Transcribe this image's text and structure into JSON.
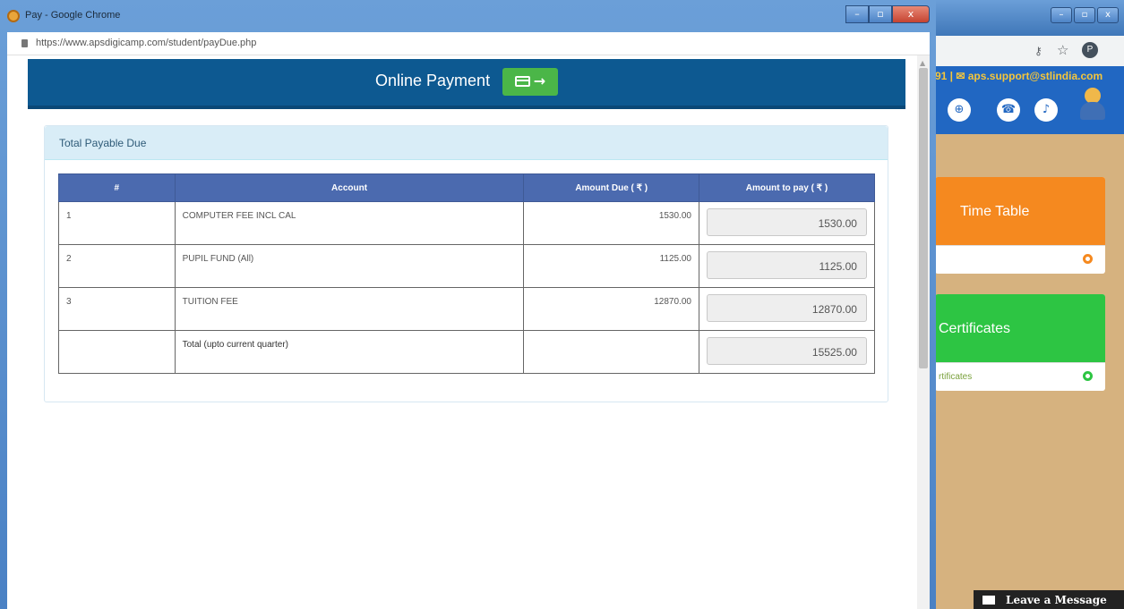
{
  "background_window": {
    "contact_text": "91 | ✉ aps.support@stlindia.com",
    "winbtns": {
      "min": "–",
      "max": "▫",
      "close": "x"
    },
    "cards": [
      {
        "title": "Time Table",
        "footer": "",
        "color": "#f5891f"
      },
      {
        "title": "Certificates",
        "footer": "rtificates",
        "color": "#2dc543"
      }
    ],
    "leave_message": "Leave a Message"
  },
  "popup": {
    "title": "Pay - Google Chrome",
    "url": "https://www.apsdigicamp.com/student/payDue.php",
    "winbtns": {
      "min": "–",
      "max": "▫",
      "close": "x"
    },
    "header_title": "Online Payment",
    "header_btn_arrow": "→"
  },
  "panel": {
    "title": "Total Payable Due",
    "columns": [
      "#",
      "Account",
      "Amount Due ( ₹ )",
      "Amount to pay ( ₹ )"
    ],
    "rows": [
      {
        "num": "1",
        "account": "COMPUTER FEE INCL CAL",
        "due": "1530.00",
        "pay": "1530.00"
      },
      {
        "num": "2",
        "account": "PUPIL FUND (All)",
        "due": "1125.00",
        "pay": "1125.00"
      },
      {
        "num": "3",
        "account": "TUITION FEE",
        "due": "12870.00",
        "pay": "12870.00"
      }
    ],
    "total_label": "Total (upto current quarter)",
    "total_value": "15525.00"
  },
  "colors": {
    "header_blue": "#0d5991",
    "pay_green": "#4bb648",
    "table_header": "#4b6aaf"
  }
}
